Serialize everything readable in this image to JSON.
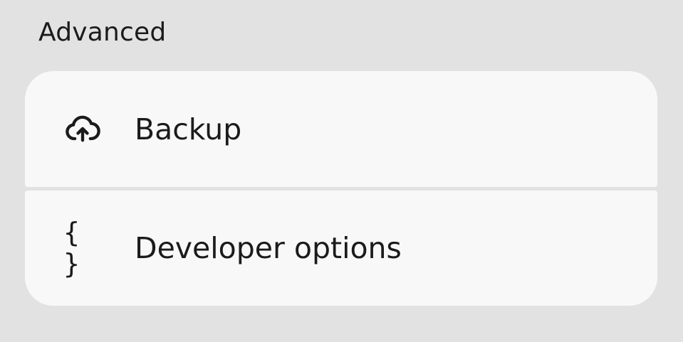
{
  "section": {
    "title": "Advanced"
  },
  "items": [
    {
      "label": "Backup",
      "icon": "cloud-upload-icon"
    },
    {
      "label": "Developer options",
      "icon": "code-braces-icon",
      "glyph": "{ }"
    }
  ]
}
